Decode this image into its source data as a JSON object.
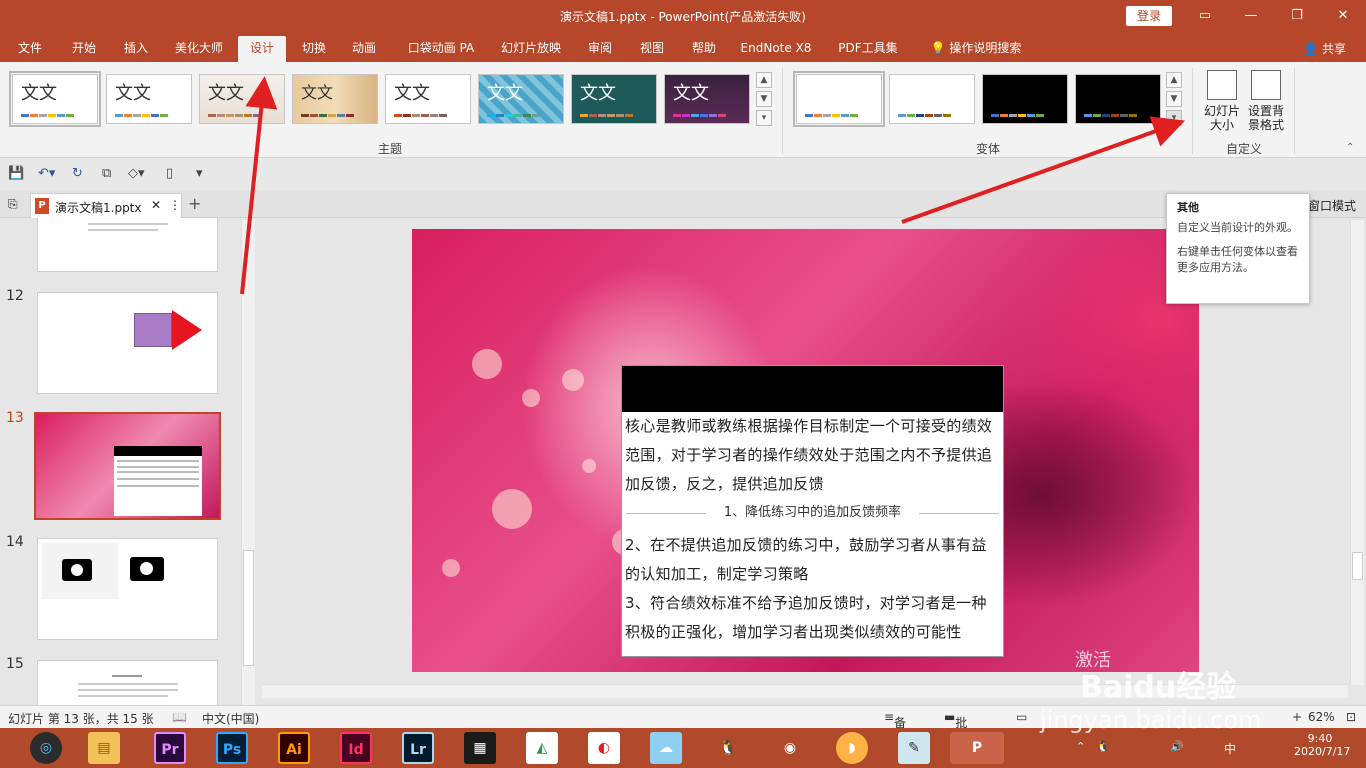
{
  "titlebar": {
    "title": "演示文稿1.pptx  -  PowerPoint(产品激活失败)",
    "login": "登录"
  },
  "menu": {
    "tabs": [
      "文件",
      "开始",
      "插入",
      "美化大师",
      "设计",
      "切换",
      "动画",
      "口袋动画 PA",
      "幻灯片放映",
      "审阅",
      "视图",
      "帮助",
      "EndNote X8",
      "PDF工具集"
    ],
    "active": "设计",
    "tell_me": "操作说明搜索",
    "share": "共享"
  },
  "ribbon": {
    "theme_label_text": "文文",
    "group_themes": "主题",
    "group_variants": "变体",
    "group_customize": "自定义",
    "slide_size_line1": "幻灯片",
    "slide_size_line2": "大小",
    "format_bg_line1": "设置背",
    "format_bg_line2": "景格式"
  },
  "doc_tab": {
    "name": "演示文稿1.pptx",
    "add": "+"
  },
  "tooltip": {
    "title": "其他",
    "line1": "自定义当前设计的外观。",
    "line2": "右键单击任何变体以查看更多应用方法。"
  },
  "view_mode_label": "窗口模式",
  "slides": {
    "numbers": [
      "12",
      "13",
      "14",
      "15"
    ],
    "current": "13"
  },
  "slide_content": {
    "para1": "核心是教师或教练根据操作目标制定一个可接受的绩效范围，对于学习者的操作绩效处于范围之内不予提供追加反馈，反之，提供追加反馈",
    "section_title": "1、降低练习中的追加反馈频率",
    "para2": "2、在不提供追加反馈的练习中，鼓励学习者从事有益的认知加工，制定学习策略",
    "para3": "3、符合绩效标准不给予追加反馈时，对学习者是一种积极的正强化，增加学习者出现类似绩效的可能性"
  },
  "status": {
    "slide_info": "幻灯片 第 13 张，共 15 张",
    "language": "中文(中国)",
    "notes": "备注",
    "comments": "批注",
    "zoom": "62%"
  },
  "taskbar": {
    "apps": [
      "Pr",
      "Ps",
      "Ai",
      "Id",
      "Lr"
    ],
    "time": "9:40",
    "date": "2020/7/17",
    "ime": "中"
  },
  "watermark": {
    "site": "jingyan.baidu.com",
    "brand": "Baidu经验",
    "activate": "激活"
  },
  "colors": {
    "accent": "#b7472a",
    "arrow": "#e02020",
    "current_slide": "#c43e1c"
  }
}
